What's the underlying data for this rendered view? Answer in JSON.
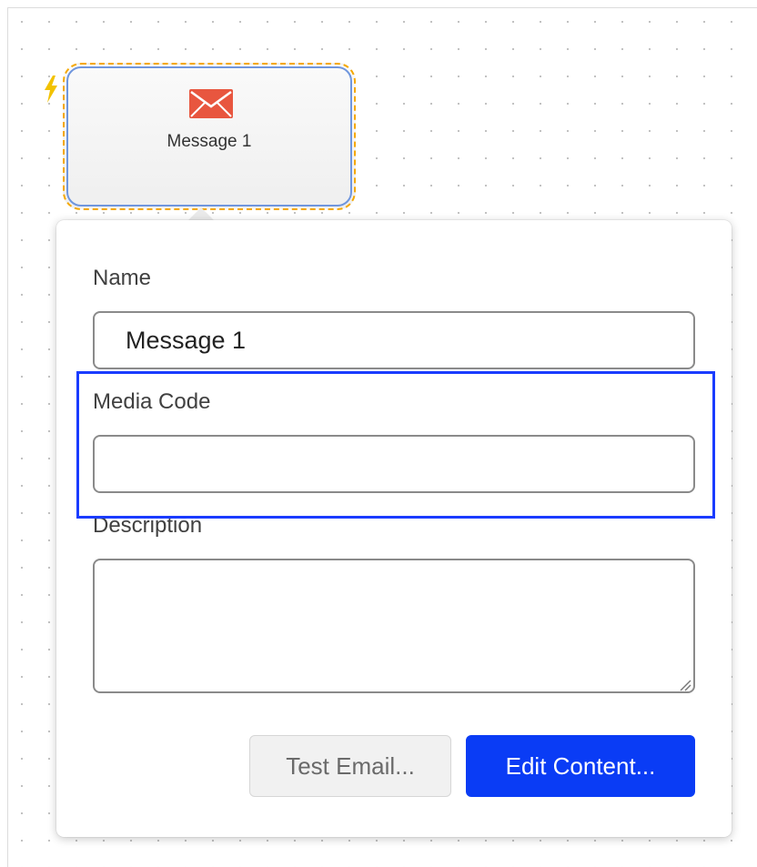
{
  "canvas": {
    "node": {
      "label": "Message 1",
      "icon": "envelope-icon",
      "trigger_icon": "lightning-bolt-icon",
      "envelope_color": "#e8563f",
      "dash_color": "#f5a800",
      "selection_color": "#6f96de"
    }
  },
  "panel": {
    "name_label": "Name",
    "name_value": "Message 1",
    "media_code_label": "Media Code",
    "media_code_value": "",
    "description_label": "Description",
    "description_value": "",
    "buttons": {
      "test_email": "Test Email...",
      "edit_content": "Edit Content..."
    },
    "colors": {
      "primary": "#0a3cf5",
      "highlight": "#1a3cff"
    }
  }
}
